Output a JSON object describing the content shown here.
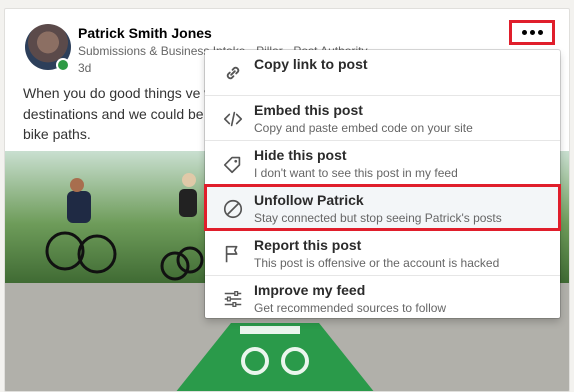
{
  "post": {
    "author_name": "Patrick Smith Jones",
    "headline": "Submissions & Business Intake · Pillar · Post Authority",
    "time_ago": "3d",
    "body_lines": [
      "When you do good things ve w",
      "destinations and we could be",
      "bike paths."
    ]
  },
  "menu": {
    "items": [
      {
        "title": "Copy link to post",
        "subtitle": "",
        "icon": "link-icon"
      },
      {
        "title": "Embed this post",
        "subtitle": "Copy and paste embed code on your site",
        "icon": "code-icon"
      },
      {
        "title": "Hide this post",
        "subtitle": "I don't want to see this post in my feed",
        "icon": "tag-icon"
      },
      {
        "title": "Unfollow Patrick",
        "subtitle": "Stay connected but stop seeing Patrick's posts",
        "icon": "block-icon"
      },
      {
        "title": "Report this post",
        "subtitle": "This post is offensive or the account is hacked",
        "icon": "flag-icon"
      },
      {
        "title": "Improve my feed",
        "subtitle": "Get recommended sources to follow",
        "icon": "sliders-icon"
      }
    ]
  },
  "colors": {
    "highlight": "#e01e2b",
    "presence": "#2e9a44",
    "bike_lane": "#2a9a4a"
  }
}
